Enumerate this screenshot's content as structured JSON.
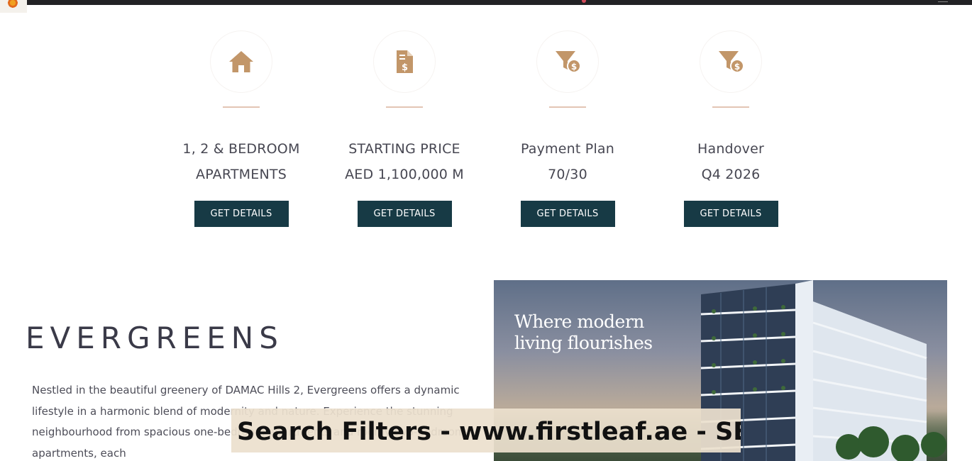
{
  "colors": {
    "accent": "#c29669",
    "button_bg": "#173a45",
    "topbar_bg": "#222225"
  },
  "features": [
    {
      "icon": "home-icon",
      "line1": "1, 2 & BEDROOM",
      "line2": "APARTMENTS",
      "button_label": "GET DETAILS"
    },
    {
      "icon": "price-document-icon",
      "line1": "STARTING PRICE",
      "line2": "AED 1,100,000 M",
      "button_label": "GET DETAILS"
    },
    {
      "icon": "payment-filter-icon",
      "line1": "Payment Plan",
      "line2": "70/30",
      "button_label": "GET DETAILS"
    },
    {
      "icon": "payment-filter-icon",
      "line1": "Handover",
      "line2": "Q4 2026",
      "button_label": "GET DETAILS"
    }
  ],
  "project": {
    "title": "EVERGREENS",
    "description": "Nestled in the beautiful greenery of DAMAC Hills 2, Evergreens offers a dynamic lifestyle in a harmonic blend of modernity and nature. Experience the stunning neighbourhood from spacious one-bedroom apartments and roomy two-bedroom apartments, each"
  },
  "hero": {
    "tagline": "Where modern\nliving flourishes"
  },
  "overlay": {
    "text": "Search Filters - www.firstleaf.ae - SE"
  }
}
